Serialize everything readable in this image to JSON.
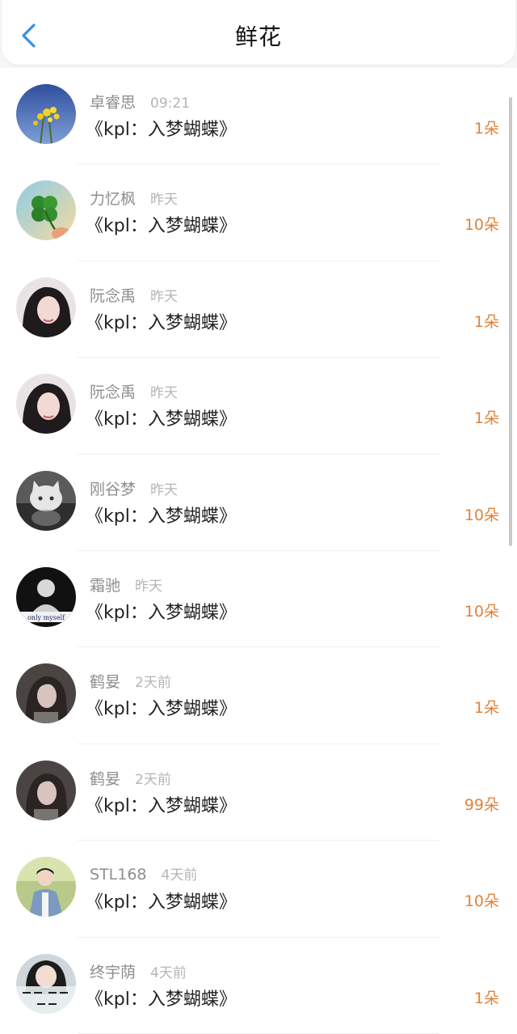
{
  "header": {
    "title": "鲜花",
    "back_icon": "chevron-left-icon",
    "accent_color": "#3a8ee6"
  },
  "rows": [
    {
      "name": "卓睿思",
      "time": "09:21",
      "work": "《kpl：入梦蝴蝶》",
      "count": "1朵",
      "avatar": "yellow-flowers-sky-avatar"
    },
    {
      "name": "力忆枫",
      "time": "昨天",
      "work": "《kpl：入梦蝴蝶》",
      "count": "10朵",
      "avatar": "four-leaf-clover-avatar"
    },
    {
      "name": "阮念禹",
      "time": "昨天",
      "work": "《kpl：入梦蝴蝶》",
      "count": "1朵",
      "avatar": "woman-portrait-avatar"
    },
    {
      "name": "阮念禹",
      "time": "昨天",
      "work": "《kpl：入梦蝴蝶》",
      "count": "1朵",
      "avatar": "woman-portrait-avatar"
    },
    {
      "name": "刚谷梦",
      "time": "昨天",
      "work": "《kpl：入梦蝴蝶》",
      "count": "10朵",
      "avatar": "white-cat-avatar"
    },
    {
      "name": "霜驰",
      "time": "昨天",
      "work": "《kpl：入梦蝴蝶》",
      "count": "10朵",
      "avatar": "dark-figure-avatar",
      "avatar_caption": "only myself"
    },
    {
      "name": "鹤妟",
      "time": "2天前",
      "work": "《kpl：入梦蝴蝶》",
      "count": "1朵",
      "avatar": "dark-girl-avatar"
    },
    {
      "name": "鹤妟",
      "time": "2天前",
      "work": "《kpl：入梦蝴蝶》",
      "count": "99朵",
      "avatar": "dark-girl-avatar"
    },
    {
      "name": "STL168",
      "time": "4天前",
      "work": "《kpl：入梦蝴蝶》",
      "count": "10朵",
      "avatar": "boy-outdoor-avatar"
    },
    {
      "name": "终宇荫",
      "time": "4天前",
      "work": "《kpl：入梦蝴蝶》",
      "count": "1朵",
      "avatar": "girl-with-text-avatar"
    }
  ],
  "count_color": "#e0833a"
}
